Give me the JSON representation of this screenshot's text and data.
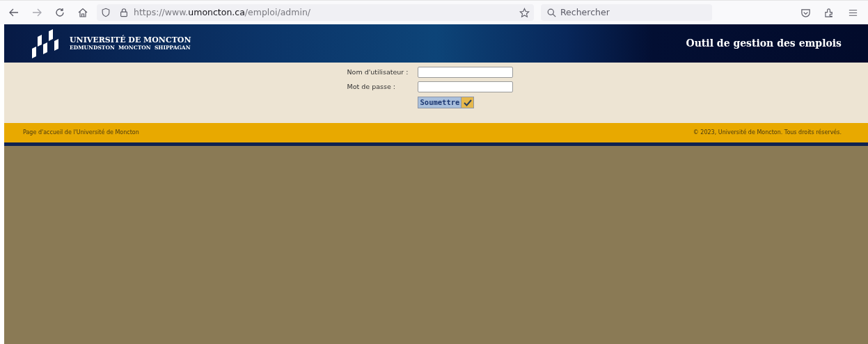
{
  "browser": {
    "url_prefix": "https://www.",
    "url_domain": "umoncton.ca",
    "url_path": "/emploi/admin/",
    "search": {
      "placeholder": "Rechercher"
    }
  },
  "banner": {
    "logo_title": "UNIVERSITÉ DE MONCTON",
    "logo_subtitle": "EDMUNDSTON  MONCTON  SHIPPAGAN",
    "title": "Outil de gestion des emplois"
  },
  "form": {
    "fields": [
      {
        "label": "Nom d'utilisateur :"
      },
      {
        "label": "Mot de passe :"
      }
    ],
    "submit": "Soumettre"
  },
  "footer": {
    "link": "Page d'accueil de l'Université de Moncton",
    "copyright": "© 2023, Université de Moncton. Tous droits réservés."
  }
}
